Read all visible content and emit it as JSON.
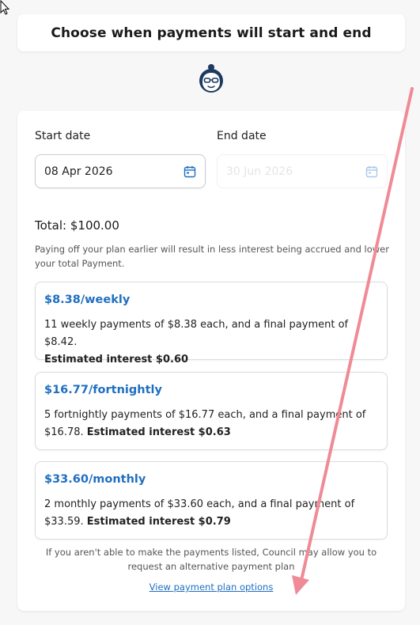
{
  "header": {
    "title": "Choose when payments will start and end"
  },
  "avatar": {
    "icon": "woman-with-glasses-icon"
  },
  "dates": {
    "start_label": "Start date",
    "start_value": "08 Apr 2026",
    "end_label": "End date",
    "end_placeholder": "30 Jun 2026",
    "calendar_icon": "calendar-icon"
  },
  "total": "Total: $100.00",
  "note": "Paying off your plan earlier will result in less interest being accrued and lower your total Payment.",
  "options": [
    {
      "title": "$8.38/weekly",
      "desc": "11 weekly payments of $8.38 each, and a final payment of $8.42.",
      "interest": "Estimated interest $0.60"
    },
    {
      "title": "$16.77/fortnightly",
      "desc": "5 fortnightly payments of $16.77 each, and a final payment of $16.78.",
      "interest": "Estimated interest $0.63"
    },
    {
      "title": "$33.60/monthly",
      "desc": "2 monthly payments of $33.60 each, and a final payment of $33.59.",
      "interest": "Estimated interest $0.79"
    }
  ],
  "footnote": "If you aren't able to make the payments listed, Council may allow you to request an alternative payment plan",
  "footlink": "View payment plan options",
  "colors": {
    "accent": "#1f6fbf",
    "annotation": "#f08a96"
  }
}
